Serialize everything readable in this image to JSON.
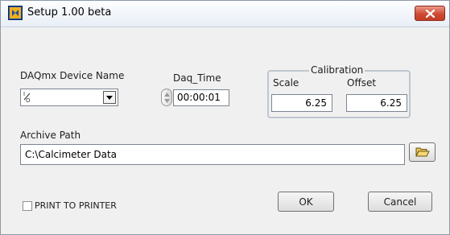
{
  "window": {
    "title": "Setup  1.00 beta",
    "icons": {
      "app": "labview-vi-icon",
      "close": "close-icon"
    }
  },
  "device": {
    "label": "DAQmx Device Name",
    "value": "",
    "io_glyph": "I/O"
  },
  "daq_time": {
    "label": "Daq_Time",
    "value": "00:00:01"
  },
  "calibration": {
    "title": "Calibration",
    "scale_label": "Scale",
    "scale_value": "6.25",
    "offset_label": "Offset",
    "offset_value": "6.25"
  },
  "archive": {
    "label": "Archive Path",
    "value": "C:\\Calcimeter Data",
    "browse_icon": "folder-open-icon"
  },
  "print": {
    "label": "PRINT TO PRINTER",
    "checked": false
  },
  "buttons": {
    "ok": "OK",
    "cancel": "Cancel"
  },
  "colors": {
    "close_button": "#cf4a33",
    "dialog_bg": "#f0f0f0"
  }
}
